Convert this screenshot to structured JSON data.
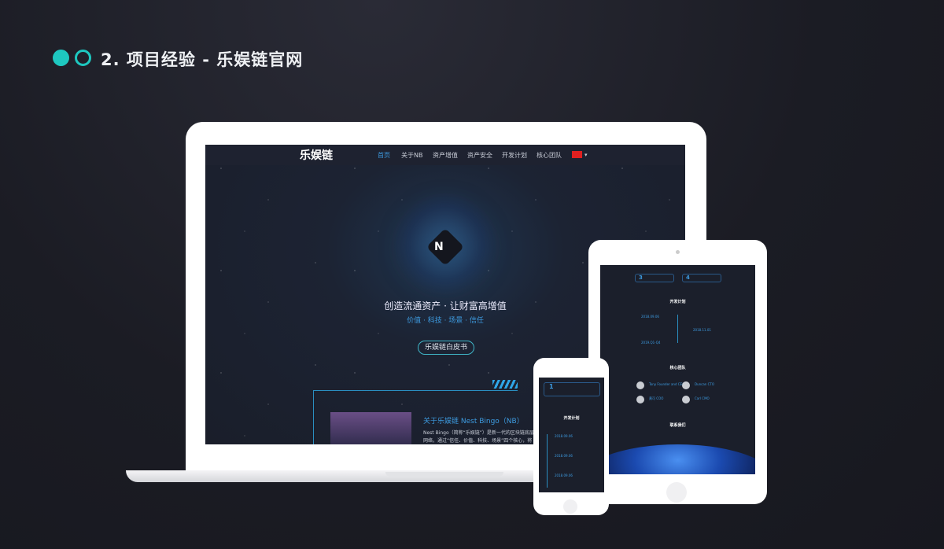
{
  "header": {
    "title": "2. 项目经验 - 乐娱链官网"
  },
  "colors": {
    "accent": "#1ec8c0",
    "background": "#1b1c24"
  },
  "laptop": {
    "nav": {
      "logo": "乐娱链",
      "items": [
        "首页",
        "关于NB",
        "资产增值",
        "资产安全",
        "开发计划",
        "核心团队"
      ],
      "language_icon": "china-flag-icon"
    },
    "hero": {
      "headline": "创造流通资产 · 让财富高增值",
      "tagline": "价值 · 科技 · 场景 · 信任",
      "cta": "乐娱链白皮书"
    },
    "about": {
      "title": "关于乐娱链 Nest Bingo（NB）",
      "line1": "Nest Bingo（简称“乐娱链”）是新一代的区块链底层",
      "line2": "网络，通过“信任、价值、科技、场景”四个核心，将"
    }
  },
  "tablet": {
    "features": [
      "3",
      "4"
    ],
    "plan_title": "开发计划",
    "dates": [
      "2018.09.06",
      "2018.11.01",
      "2019.Q1-Q4"
    ],
    "team_title": "核心团队",
    "team": [
      "Tony Founder and CEO",
      "Duncan CTO",
      "黄可 COO",
      "Carl CMO"
    ],
    "contact_title": "联系我们"
  },
  "phone": {
    "feature_num": "1",
    "plan_title": "开发计划",
    "dates": [
      "2018.09.06",
      "2018.09.06",
      "2018.09.06"
    ]
  }
}
